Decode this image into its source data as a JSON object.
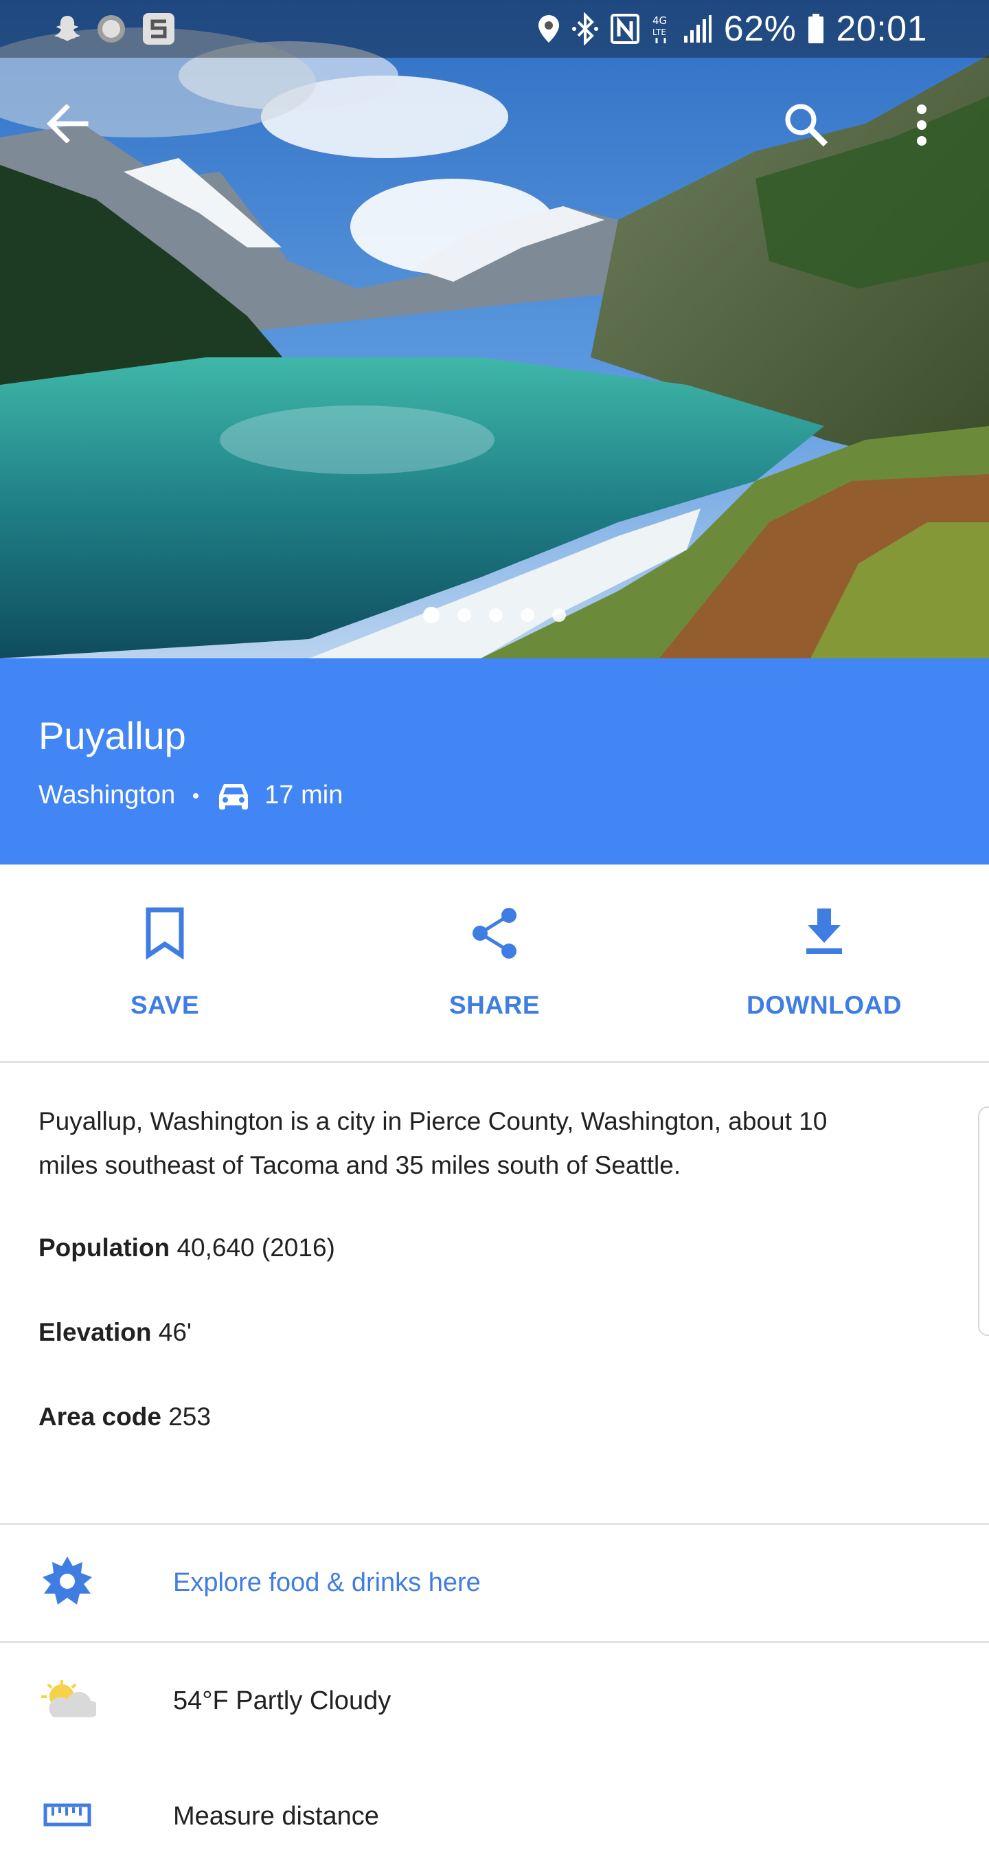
{
  "status_bar": {
    "left_icons": [
      "snapchat-icon",
      "circle-notification-icon",
      "s-app-icon"
    ],
    "right_icons": [
      "location-icon",
      "bluetooth-icon",
      "nfc-icon",
      "4g-lte-icon",
      "signal-icon"
    ],
    "battery": "62%",
    "time": "20:01"
  },
  "app_bar": {
    "back_icon": "arrow-back-icon",
    "search_icon": "search-icon",
    "menu_icon": "more-vert-icon"
  },
  "gallery": {
    "page_count": 5,
    "active_index": 0
  },
  "place": {
    "name": "Puyallup",
    "region": "Washington",
    "travel_mode_icon": "car-icon",
    "travel_time": "17 min"
  },
  "actions": [
    {
      "label": "SAVE",
      "icon": "bookmark-icon"
    },
    {
      "label": "SHARE",
      "icon": "share-icon"
    },
    {
      "label": "DOWNLOAD",
      "icon": "download-icon"
    }
  ],
  "description": "Puyallup, Washington is a city in Pierce County, Washington, about 10 miles southeast of Tacoma and 35 miles south of Seattle.",
  "facts": [
    {
      "label": "Population",
      "value": "40,640 (2016)"
    },
    {
      "label": "Elevation",
      "value": "46'"
    },
    {
      "label": "Area code",
      "value": "253"
    }
  ],
  "rows": [
    {
      "text": "Explore food & drinks here",
      "icon": "explore-icon"
    },
    {
      "text": "54°F Partly Cloudy",
      "icon": "partly-cloudy-icon"
    },
    {
      "text": "Measure distance",
      "icon": "ruler-icon"
    }
  ],
  "colors": {
    "accent": "#4285f4",
    "link": "#3f7de3",
    "text": "#212121"
  }
}
